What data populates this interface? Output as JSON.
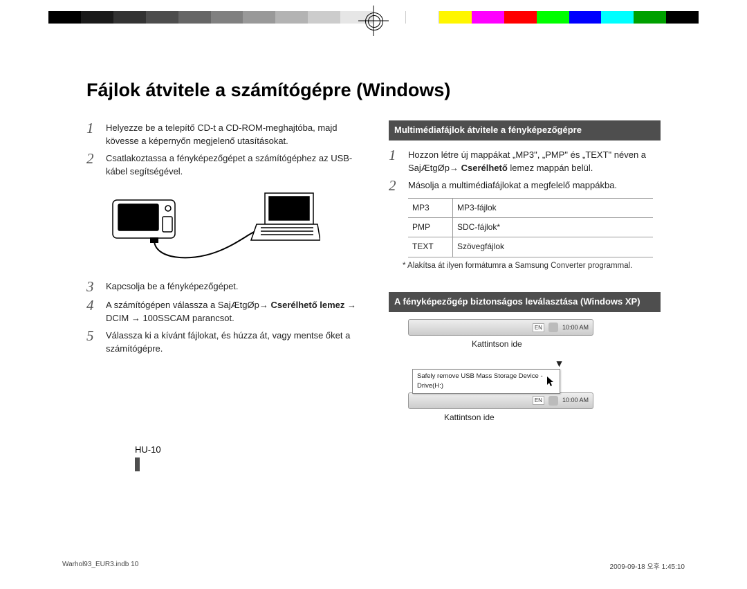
{
  "title": "Fájlok átvitele a számítógépre (Windows)",
  "left": {
    "s1": "Helyezze be a telepítő CD-t a CD-ROM-meghajtóba, majd kövesse a képernyőn megjelenő utasításokat.",
    "s2": "Csatlakoztassa a fényképezőgépet a számítógéphez az USB-kábel segítségével.",
    "s3": "Kapcsolja be a fényképezőgépet.",
    "s4a": "A számítógépen válassza a SajÆtgØp→ ",
    "s4b": "Cserélhető lemez",
    "s4c": " → DCIM → 100SSCAM parancsot.",
    "s5": "Válassza ki a kívánt fájlokat, és húzza át, vagy mentse őket a számítógépre."
  },
  "right": {
    "h1": "Multimédiafájlok átvitele a fényképezőgépre",
    "s1a": "Hozzon létre új mappákat „MP3\", „PMP\" és „TEXT\" néven a SajÆtgØp→ ",
    "s1b": "Cserélhető",
    "s1c": " lemez mappán belül.",
    "s2": "Másolja a multimédiafájlokat a megfelelő mappákba.",
    "table": [
      {
        "a": "MP3",
        "b": "MP3-fájlok"
      },
      {
        "a": "PMP",
        "b": "SDC-fájlok*"
      },
      {
        "a": "TEXT",
        "b": "Szövegfájlok"
      }
    ],
    "foot": "* Alakítsa át ilyen formátumra a Samsung Converter programmal.",
    "h2": "A fényképezőgép biztonságos leválasztása (Windows XP)",
    "click": "Kattintson ide",
    "tray_lang": "EN",
    "tray_time": "10:00 AM",
    "popup": "Safely remove USB Mass Storage Device - Drive(H:)"
  },
  "pagenum": "HU-10",
  "footer_left": "Warhol93_EUR3.indb   10",
  "footer_right": "2009-09-18   오후 1:45:10",
  "colorbar": [
    "#000",
    "#1a1a1a",
    "#333",
    "#4d4d4d",
    "#666",
    "#808080",
    "#999",
    "#b3b3b3",
    "#ccc",
    "#e6e6e6",
    "#fff",
    "#fff",
    "#fff600",
    "#ff00ff",
    "#ff0000",
    "#00ff00",
    "#0000ff",
    "#00ffff",
    "#00a000",
    "#000"
  ]
}
